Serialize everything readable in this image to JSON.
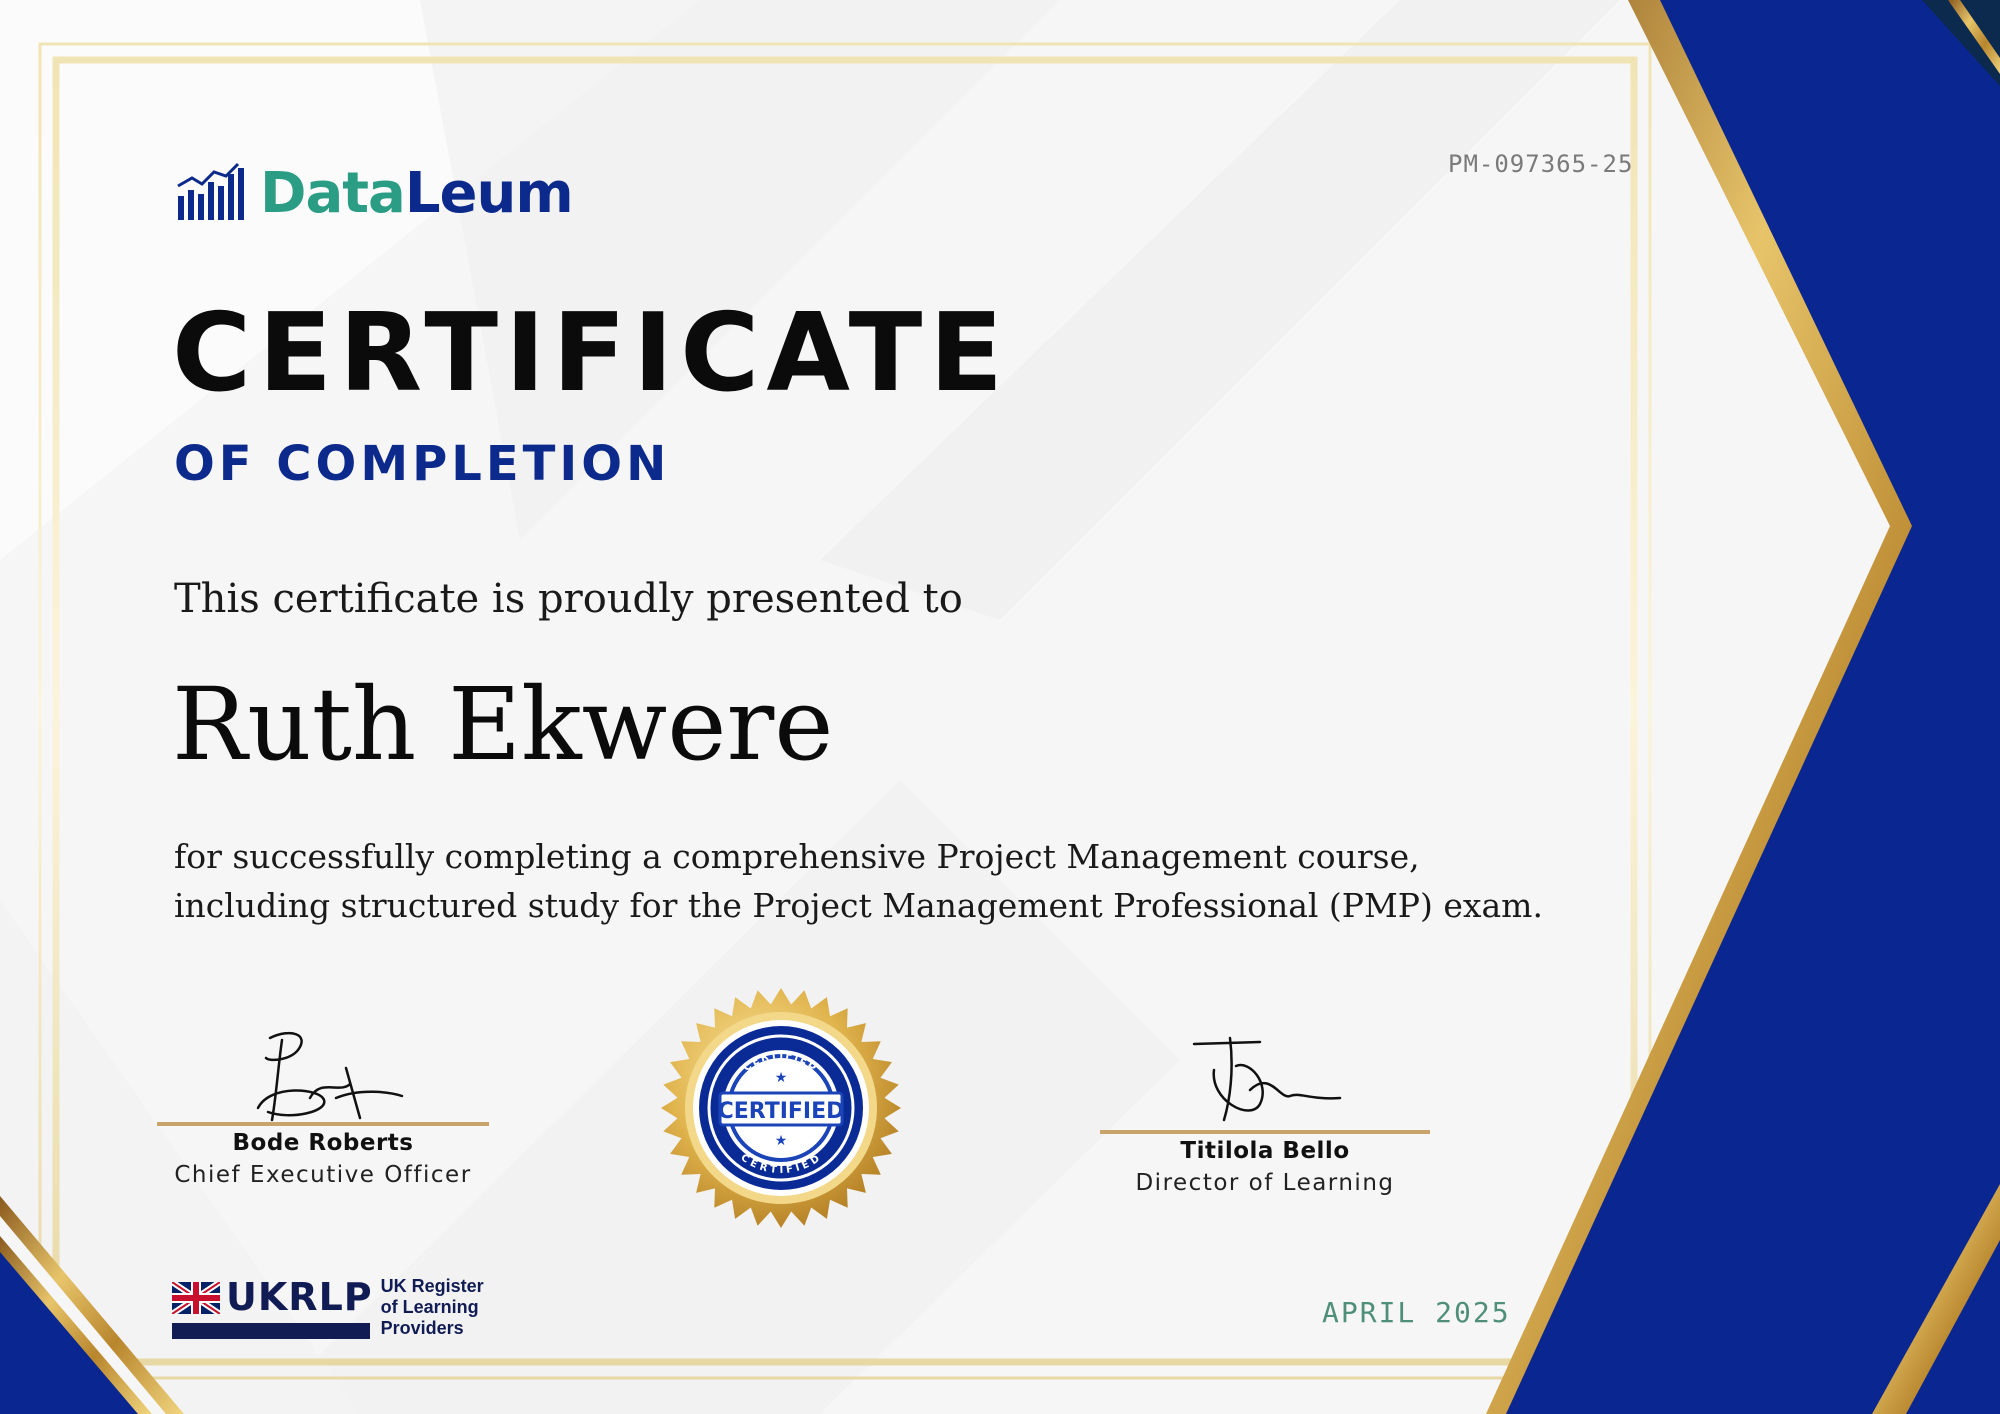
{
  "certificate": {
    "id": "PM-097365-25",
    "title": "CERTIFICATE",
    "subtitle": "OF COMPLETION",
    "presented_text": "This certificate is proudly presented to",
    "recipient": "Ruth Ekwere",
    "description_line1": "for successfully completing a comprehensive Project Management course,",
    "description_line2": "including structured study for the Project Management Professional (PMP) exam.",
    "date": "APRIL 2025"
  },
  "brand": {
    "name_part1": "Data",
    "name_part2": "Leum",
    "colors": {
      "teal": "#2a9d84",
      "navy": "#0c2a8c",
      "gold": "#c9a46a"
    }
  },
  "signatories": [
    {
      "name": "Bode Roberts",
      "role": "Chief Executive Officer"
    },
    {
      "name": "Titilola Bello",
      "role": "Director of Learning"
    }
  ],
  "seal": {
    "label": "CERTIFIED",
    "ring_text": "CERTIFIED"
  },
  "accreditation": {
    "name": "UKRLP",
    "line1": "UK Register",
    "line2": "of Learning",
    "line3": "Providers"
  },
  "icons": [
    "bar-chart-logo-icon",
    "uk-flag-icon",
    "seal-icon",
    "star-icon"
  ]
}
